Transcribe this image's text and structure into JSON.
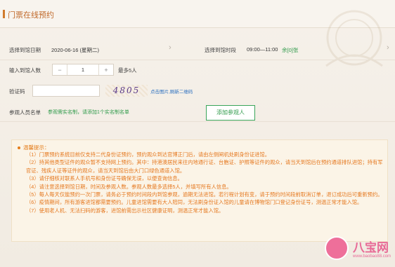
{
  "header": {
    "title": "门票在线预约"
  },
  "date_row": {
    "date_label": "选择到馆日期",
    "date_value": "2020-06-16 (星期二)",
    "slot_label": "选择到馆时段",
    "slot_time": "09:00—11:00",
    "slot_remain": "余[0]张"
  },
  "count_row": {
    "label": "输入到馆人数",
    "minus": "−",
    "value": "1",
    "plus": "+",
    "max_note": "最多5人"
  },
  "captcha_row": {
    "label": "验证码",
    "captcha_text": "4805",
    "refresh_text": "点击图片,刷新二维码"
  },
  "visitor_row": {
    "label": "参观人员名单",
    "note": "参观需实名制，请添加1个实名制名单",
    "add_button": "添加参观人"
  },
  "tips": {
    "heading": "温馨提示：",
    "items": [
      "（1）门票预约系统目前仅支持二代身份证预约，预约观众到达官博正门后，请由左侧闸机处刷身份证进馆。",
      "（2）持其他类型证件的观众暂不支持网上预约。其中：持港澳居民来往内地通行证、台胞证、护照等证件的观众，请当天到馆后在预约通道排队进馆；持有军官证、残疾人证等证件的观众，请当天到馆后由大门口绿色通道入馆。",
      "（3）请仔细核对联系人手机号和身份证号确保无误，以便查询信息。",
      "（4）请注意选择到馆日期，时间及参观人数。参观人数最多选择5人，并填写所有人信息。",
      "（5）每人每天仅能预约一次门票，请务必于预约时间段内到馆参观，逾期无法进馆。若行程计划有变，请于预约时间段前取消订单，退订成功后可重新预约。",
      "（6）疫情期间，所有游客进馆都需要预约。儿童进馆需要有大人陪同，无法刷身份证入馆的儿童请在博物馆门口登记身份证号，测温正常才能入馆。",
      "（7）使用老人机、无法扫码的游客，进馆前需出示社区健康证明，测温正常才能入馆。"
    ]
  },
  "watermark": {
    "name": "八宝网",
    "url": "www.baobao88.com"
  },
  "colors": {
    "accent": "#d07a2c",
    "green": "#2f9a4a",
    "tips_text": "#e5781f",
    "link": "#2a6fbf"
  },
  "icons": [
    "chevron-right-icon",
    "chevron-right-icon",
    "info-dot-icon"
  ]
}
